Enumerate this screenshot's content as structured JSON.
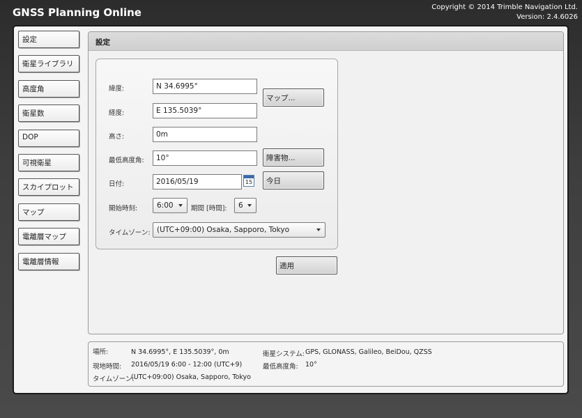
{
  "app": {
    "title": "GNSS Planning Online",
    "copyright": "Copyright © 2014 Trimble Navigation Ltd.",
    "version": "Version: 2.4.6026"
  },
  "nav": {
    "items": [
      {
        "label": "設定"
      },
      {
        "label": "衛星ライブラリ"
      },
      {
        "label": "高度角"
      },
      {
        "label": "衛星数"
      },
      {
        "label": "DOP"
      },
      {
        "label": "可視衛星"
      },
      {
        "label": "スカイプロット"
      },
      {
        "label": "マップ"
      },
      {
        "label": "電離層マップ"
      },
      {
        "label": "電離層情報"
      }
    ]
  },
  "settings": {
    "title": "設定",
    "latitude_label": "緯度:",
    "latitude_value": "N 34.6995°",
    "longitude_label": "経度:",
    "longitude_value": "E 135.5039°",
    "height_label": "高さ:",
    "height_value": "0m",
    "min_elev_label": "最低高度角:",
    "min_elev_value": "10°",
    "date_label": "日付:",
    "date_value": "2016/05/19",
    "calendar_day": "15",
    "start_time_label": "開始時刻:",
    "start_time_value": "6:00",
    "period_label": "期間 [時間]:",
    "period_value": "6",
    "timezone_label": "タイムゾーン:",
    "timezone_value": "(UTC+09:00) Osaka, Sapporo, Tokyo",
    "map_button": "マップ...",
    "obstruction_button": "障害物...",
    "today_button": "今日",
    "apply_button": "適用"
  },
  "status": {
    "location_label": "場所:",
    "location_value": "N 34.6995°, E 135.5039°, 0m",
    "local_time_label": "現地時間:",
    "local_time_value": "2016/05/19 6:00 - 12:00 (UTC+9)",
    "timezone_label": "タイムゾーン:",
    "timezone_value": "(UTC+09:00) Osaka, Sapporo, Tokyo",
    "systems_label": "衛星システム:",
    "systems_value": "GPS, GLONASS, Galileo, BeiDou, QZSS",
    "min_elev_label": "最低高度角:",
    "min_elev_value": "10°"
  }
}
